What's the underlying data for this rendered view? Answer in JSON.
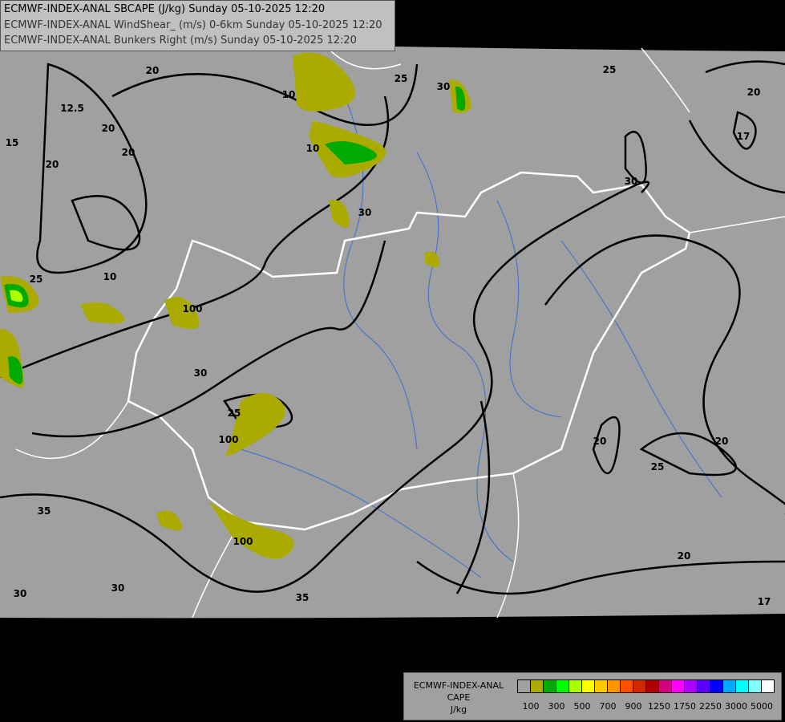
{
  "header": {
    "line1": "ECMWF-INDEX-ANAL SBCAPE (J/kg) Sunday 05-10-2025 12:20",
    "line2": "ECMWF-INDEX-ANAL WindShear_ (m/s) 0-6km Sunday 05-10-2025 12:20",
    "line3": "ECMWF-INDEX-ANAL Bunkers Right (m/s) Sunday 05-10-2025 12:20"
  },
  "map": {
    "background_color": "#a0a0a0",
    "outside_color": "#000000",
    "border_color": "#ffffff",
    "river_color": "#3a6fd0",
    "contour_color": "#000000",
    "contour_labels": [
      "20",
      "25",
      "30",
      "25",
      "20",
      "17",
      "30",
      "20",
      "15",
      "20",
      "12.5",
      "10",
      "25",
      "20",
      "30",
      "25",
      "100",
      "20",
      "25",
      "20",
      "35",
      "30",
      "30",
      "35",
      "100",
      "20",
      "17",
      "30",
      "10",
      "10",
      "100"
    ]
  },
  "legend": {
    "title_line1": "ECMWF-INDEX-ANAL",
    "title_line2": "CAPE",
    "unit": "J/kg",
    "colors": [
      "#a0a0a0",
      "#aaaa00",
      "#00aa00",
      "#00ff00",
      "#aaff00",
      "#ffff00",
      "#ffc800",
      "#ff9600",
      "#ff5000",
      "#d22800",
      "#aa0000",
      "#d2007d",
      "#ff00ff",
      "#aa00ff",
      "#5a00ff",
      "#0000ff",
      "#00aaff",
      "#00ffff",
      "#80ffff",
      "#ffffff"
    ],
    "tick_labels": [
      "100",
      "300",
      "500",
      "700",
      "900",
      "1250",
      "1750",
      "2250",
      "3000",
      "5000"
    ]
  }
}
